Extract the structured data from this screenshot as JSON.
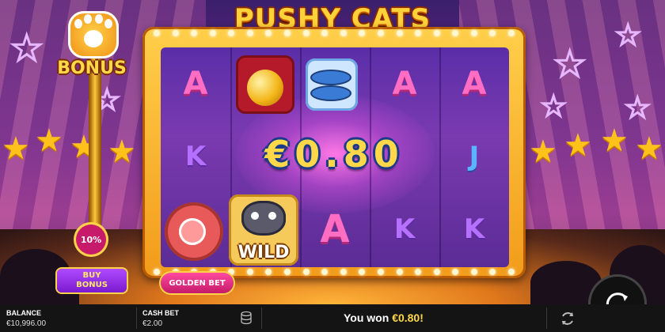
{
  "game": {
    "logo_text": "PUSHY CATS",
    "win_display": "€0.80"
  },
  "bonus": {
    "label": "BONUS",
    "progress_percent_label": "10%",
    "progress_fraction": 0.1,
    "buy_bonus_line1": "BUY",
    "buy_bonus_line2": "BONUS",
    "golden_bet_label": "GOLDEN BET"
  },
  "reels": {
    "row1": [
      "A",
      "bell",
      "fish",
      "A",
      "A"
    ],
    "row2": [
      "K",
      "",
      "",
      "",
      "J"
    ],
    "row3": [
      "ham",
      "wild",
      "A",
      "K",
      "K"
    ],
    "wild_label": "WILD"
  },
  "status_bar": {
    "balance_label": "BALANCE",
    "balance_value": "€10,996.00",
    "cash_bet_label": "CASH BET",
    "cash_bet_value": "€2.00",
    "win_message_prefix": "You won ",
    "win_message_amount": "€0.80!"
  },
  "icons": {
    "spin": "spin-icon",
    "autoplay": "autoplay-icon",
    "coins": "coins-icon",
    "paw": "paw-icon"
  },
  "colors": {
    "gold": "#ffd84a",
    "magenta": "#ff6ec3",
    "purple_reel": "#5a2ea8"
  }
}
